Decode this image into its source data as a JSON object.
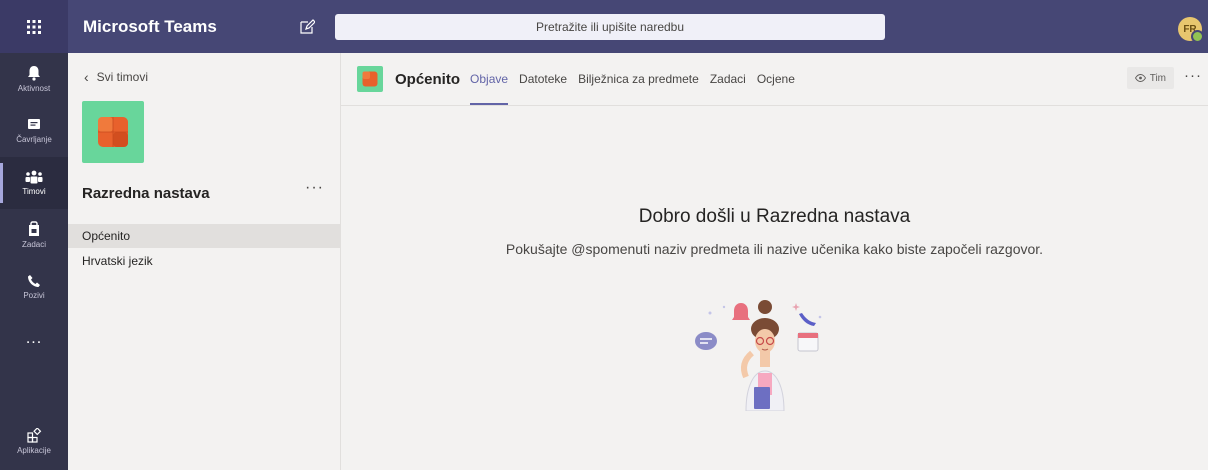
{
  "app": {
    "title": "Microsoft Teams"
  },
  "search": {
    "placeholder": "Pretražite ili upišite naredbu"
  },
  "user": {
    "initials": "FR"
  },
  "rail": {
    "items": [
      {
        "label": "Aktivnost",
        "icon": "bell-icon"
      },
      {
        "label": "Čavrljanje",
        "icon": "chat-icon"
      },
      {
        "label": "Timovi",
        "icon": "teams-icon",
        "active": true
      },
      {
        "label": "Zadaci",
        "icon": "assignments-icon"
      },
      {
        "label": "Pozivi",
        "icon": "phone-icon"
      },
      {
        "label": "...",
        "icon": "more-icon"
      },
      {
        "label": "Aplikacije",
        "icon": "apps-icon"
      }
    ]
  },
  "team": {
    "back_label": "Svi timovi",
    "name": "Razredna nastava",
    "more": "···",
    "channels": [
      {
        "label": "Općenito",
        "selected": true
      },
      {
        "label": "Hrvatski jezik"
      }
    ]
  },
  "channel": {
    "name": "Općenito",
    "tabs": [
      {
        "label": "Objave",
        "active": true
      },
      {
        "label": "Datoteke"
      },
      {
        "label": "Bilježnica za predmete"
      },
      {
        "label": "Zadaci"
      },
      {
        "label": "Ocjene"
      }
    ],
    "team_button": "Tim",
    "more": "···"
  },
  "welcome": {
    "title": "Dobro došli u Razredna nastava",
    "subtitle": "Pokušajte @spomenuti naziv predmeta ili nazive učenika kako biste započeli razgovor."
  },
  "colors": {
    "topbar": "#464775",
    "rail": "#33344a",
    "accent": "#6264a7",
    "team_tile": "#68d69b",
    "team_icon": "#e8612c"
  }
}
